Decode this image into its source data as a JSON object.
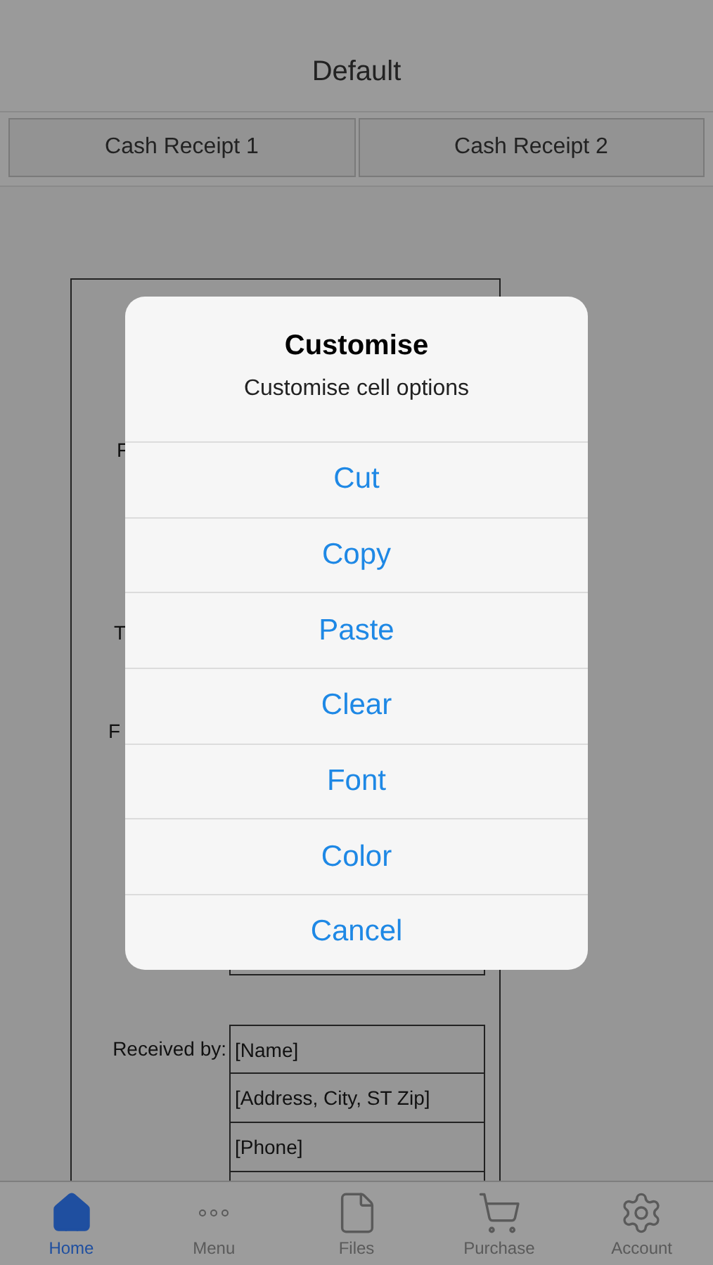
{
  "header": {
    "title": "Default"
  },
  "sheet_tabs": [
    {
      "label": "Cash Receipt 1",
      "selected": false
    },
    {
      "label": "Cash Receipt 2",
      "selected": false
    }
  ],
  "receipt": {
    "partial_labels": [
      "F",
      "T",
      "F"
    ],
    "received_label": "Received by:",
    "received_fields": [
      "[Name]",
      "[Address, City, ST  Zip]",
      "[Phone]"
    ]
  },
  "dialog": {
    "title": "Customise",
    "message": "Customise cell options",
    "actions": [
      "Cut",
      "Copy",
      "Paste",
      "Clear",
      "Font",
      "Color",
      "Cancel"
    ]
  },
  "tab_bar": [
    {
      "kind": "home",
      "label": "Home",
      "selected": true
    },
    {
      "kind": "menu",
      "label": "Menu",
      "selected": false
    },
    {
      "kind": "files",
      "label": "Files",
      "selected": false
    },
    {
      "kind": "purchase",
      "label": "Purchase",
      "selected": false
    },
    {
      "kind": "account",
      "label": "Account",
      "selected": false
    }
  ]
}
